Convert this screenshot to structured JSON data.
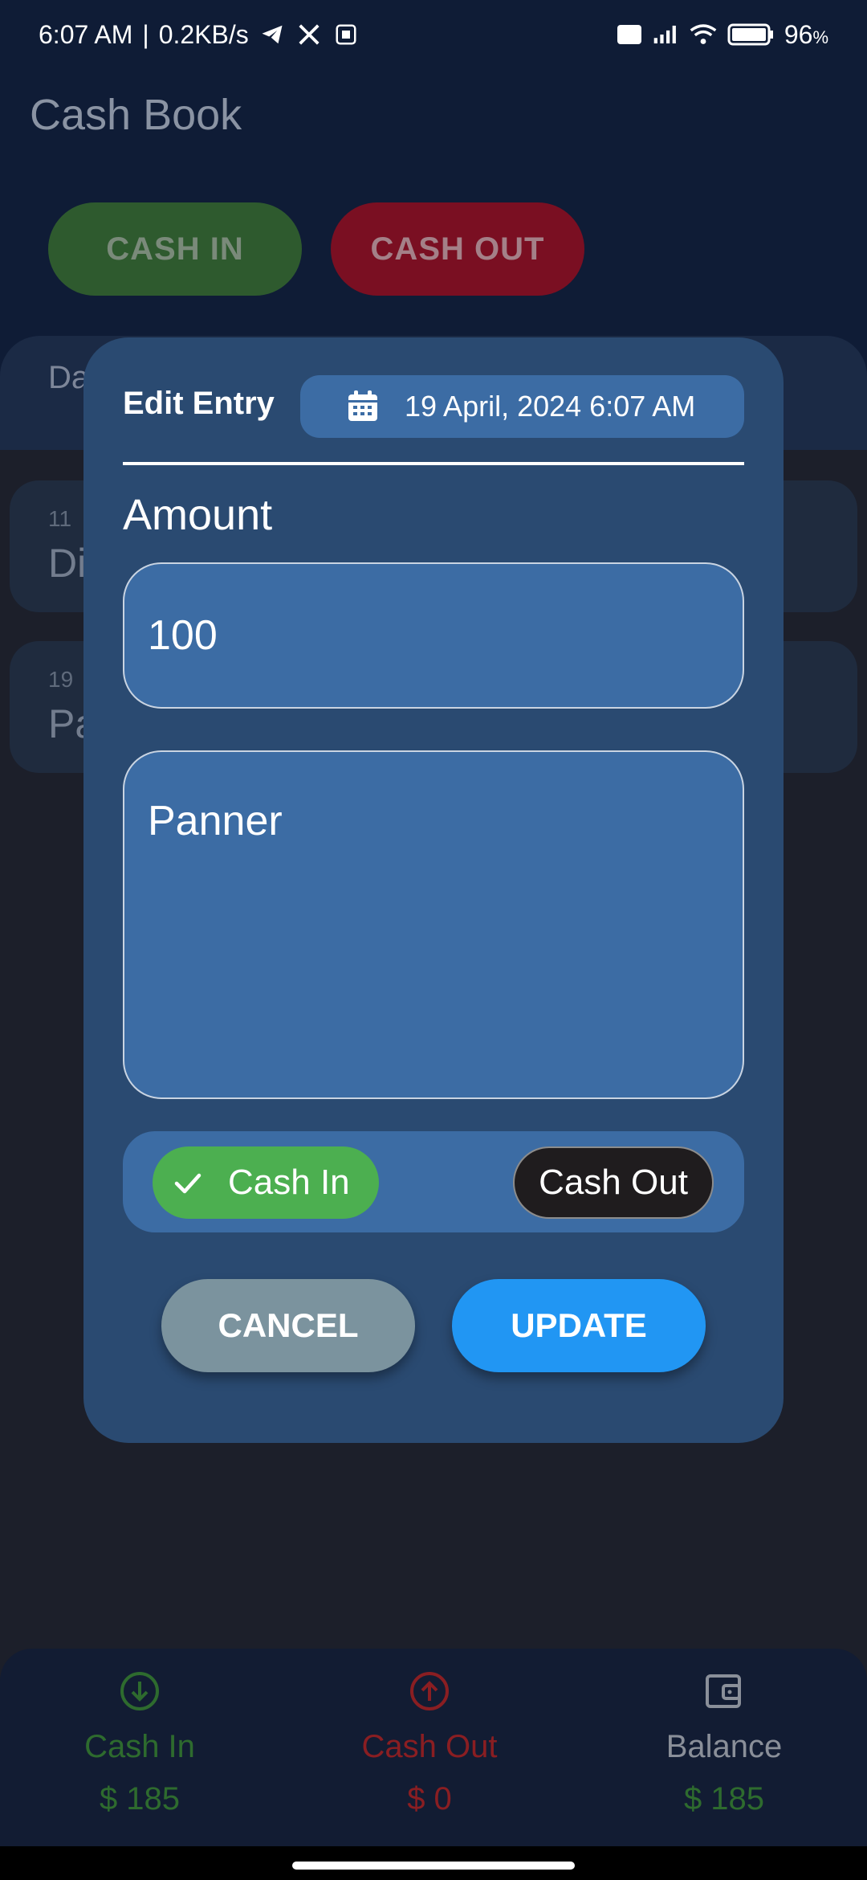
{
  "status_bar": {
    "time": "6:07 AM",
    "speed": "0.2KB/s",
    "battery": "96"
  },
  "app": {
    "title": "Cash Book",
    "cash_in_button": "CASH IN",
    "cash_out_button": "CASH OUT",
    "date_header": "Da",
    "entries": [
      {
        "date": "11",
        "name": "Di"
      },
      {
        "date": "19",
        "name": "Pa"
      }
    ]
  },
  "dialog": {
    "title": "Edit Entry",
    "datetime": "19 April, 2024 6:07 AM",
    "amount_label": "Amount",
    "amount_value": "100",
    "note_value": "Panner",
    "toggle_cash_in": "Cash In",
    "toggle_cash_out": "Cash Out",
    "selected_type": "Cash In",
    "cancel_label": "CANCEL",
    "update_label": "UPDATE"
  },
  "bottom_nav": {
    "items": [
      {
        "label": "Cash In",
        "value": "$ 185",
        "icon": "arrow-down-circle-icon",
        "color": "#2e6b2e"
      },
      {
        "label": "Cash Out",
        "value": "$ 0",
        "icon": "arrow-up-circle-icon",
        "color": "#8a1e22"
      },
      {
        "label": "Balance",
        "value": "$ 185",
        "icon": "wallet-icon",
        "color": "#8a8f99"
      }
    ],
    "balance_value_color": "#2e6b2e"
  },
  "colors": {
    "dialog_bg": "#2a4a71",
    "field_bg": "#3c6ca4",
    "selected_green": "#4caf50",
    "update_blue": "#2196f3",
    "cancel_grey": "#7b939e"
  }
}
